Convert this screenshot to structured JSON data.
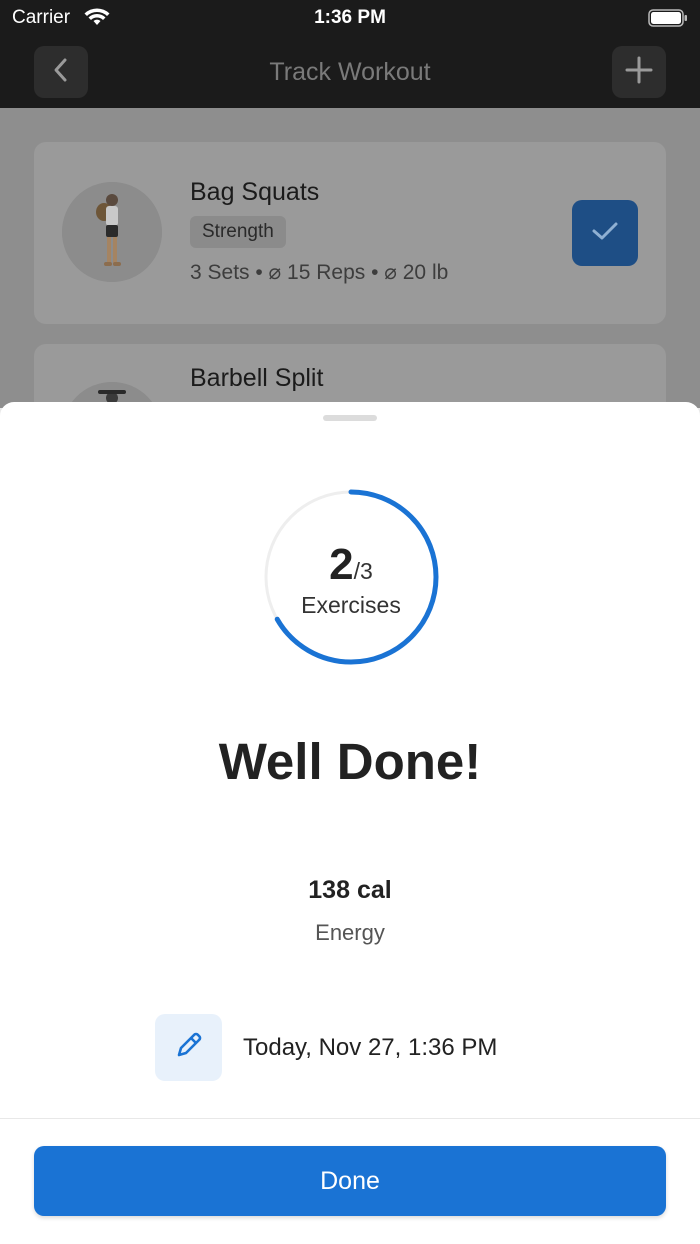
{
  "status_bar": {
    "carrier": "Carrier",
    "time": "1:36 PM",
    "wifi_icon": "wifi-icon",
    "battery_icon": "battery-icon"
  },
  "nav": {
    "title": "Track Workout",
    "back_icon": "chevron-left-icon",
    "add_icon": "plus-icon"
  },
  "workout_list": [
    {
      "title": "Bag Squats",
      "tag": "Strength",
      "meta": "3 Sets • ⌀ 15 Reps • ⌀ 20 lb",
      "completed": true
    },
    {
      "title": "Barbell Split"
    }
  ],
  "summary_sheet": {
    "completed_count": "2",
    "total_count": "/3",
    "progress_fraction": 0.667,
    "progress_label": "Exercises",
    "headline": "Well Done!",
    "energy_value": "138 cal",
    "energy_label": "Energy",
    "datetime": "Today, Nov 27, 1:36 PM",
    "edit_icon": "pencil-icon",
    "done_label": "Done"
  },
  "colors": {
    "accent": "#1a73d4",
    "ring_track": "#eeeeee",
    "nav_background": "#1b1b1b"
  }
}
